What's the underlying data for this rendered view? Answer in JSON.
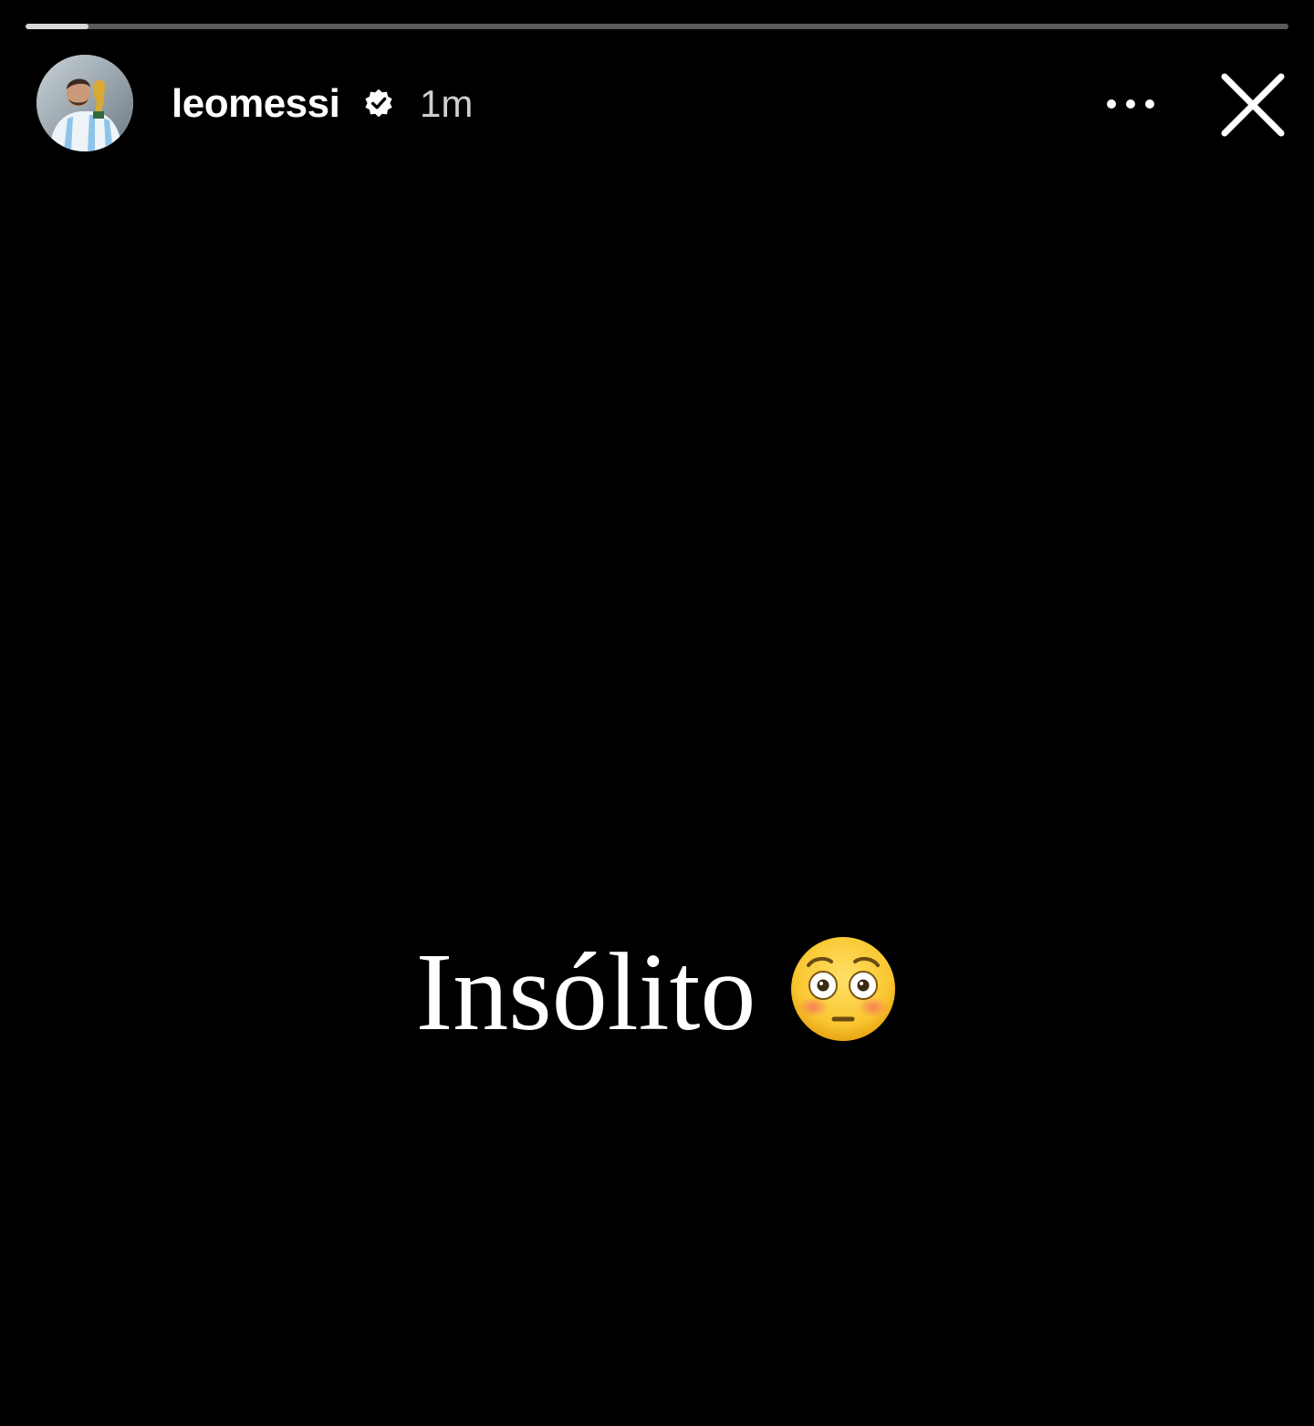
{
  "story": {
    "progress": 0.05,
    "header": {
      "username": "leomessi",
      "verified": true,
      "time_ago": "1m",
      "avatar_icon": "profile-photo",
      "more_icon": "more-dots-icon",
      "close_icon": "close-icon"
    },
    "content": {
      "text": "Insólito",
      "emoji_icon": "flushed-face-emoji"
    },
    "colors": {
      "background": "#000000",
      "text": "#ffffff",
      "progress_track": "#5a5a5a",
      "progress_fill": "#d8d8d8"
    }
  }
}
